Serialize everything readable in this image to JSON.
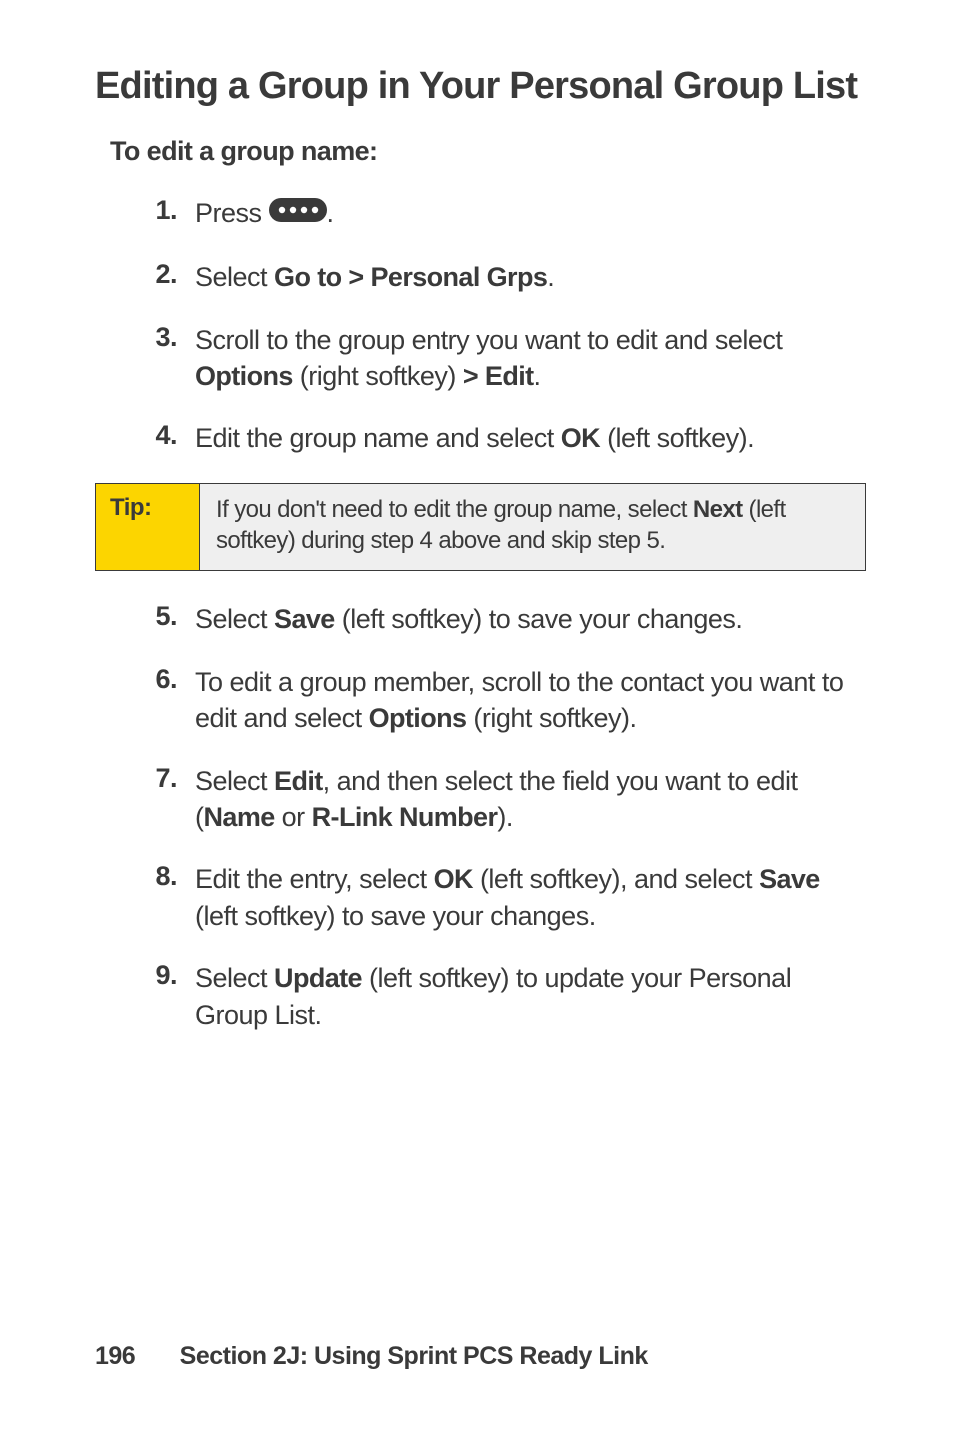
{
  "heading": "Editing a Group in Your Personal Group List",
  "subheading": "To edit a group name:",
  "steps_a": [
    {
      "num": "1.",
      "parts": [
        {
          "t": "Press "
        },
        {
          "icon": true
        },
        {
          "t": "."
        }
      ]
    },
    {
      "num": "2.",
      "parts": [
        {
          "t": "Select "
        },
        {
          "b": "Go to > Personal Grps"
        },
        {
          "t": "."
        }
      ]
    },
    {
      "num": "3.",
      "parts": [
        {
          "t": "Scroll to the group entry you want to edit and select "
        },
        {
          "b": "Options"
        },
        {
          "t": " (right softkey) "
        },
        {
          "b": "> Edit"
        },
        {
          "t": "."
        }
      ]
    },
    {
      "num": "4.",
      "parts": [
        {
          "t": "Edit the group name and select "
        },
        {
          "b": "OK"
        },
        {
          "t": " (left softkey)."
        }
      ]
    }
  ],
  "tip": {
    "label": "Tip:",
    "parts": [
      {
        "t": "If you don't need to edit the group name, select "
      },
      {
        "b": "Next"
      },
      {
        "t": " (left softkey) during step 4 above and skip step 5."
      }
    ]
  },
  "steps_b": [
    {
      "num": "5.",
      "parts": [
        {
          "t": "Select "
        },
        {
          "b": "Save"
        },
        {
          "t": " (left softkey) to save your changes."
        }
      ]
    },
    {
      "num": "6.",
      "parts": [
        {
          "t": "To edit a group member, scroll to the contact you want to edit and select "
        },
        {
          "b": "Options"
        },
        {
          "t": " (right softkey)."
        }
      ]
    },
    {
      "num": "7.",
      "parts": [
        {
          "t": "Select "
        },
        {
          "b": "Edit"
        },
        {
          "t": ", and then select the field you want to edit ("
        },
        {
          "b": "Name"
        },
        {
          "t": " or "
        },
        {
          "b": "R-Link Number"
        },
        {
          "t": ")."
        }
      ]
    },
    {
      "num": "8.",
      "parts": [
        {
          "t": "Edit the entry, select "
        },
        {
          "b": "OK"
        },
        {
          "t": " (left softkey), and select "
        },
        {
          "b": "Save"
        },
        {
          "t": " (left softkey) to save your changes."
        }
      ]
    },
    {
      "num": "9.",
      "parts": [
        {
          "t": "Select "
        },
        {
          "b": "Update"
        },
        {
          "t": " (left softkey) to update your Personal Group List."
        }
      ]
    }
  ],
  "footer": {
    "page": "196",
    "section": "Section 2J: Using Sprint PCS Ready Link"
  },
  "icons": {
    "four_dot_key": "four-dot-key-icon"
  }
}
